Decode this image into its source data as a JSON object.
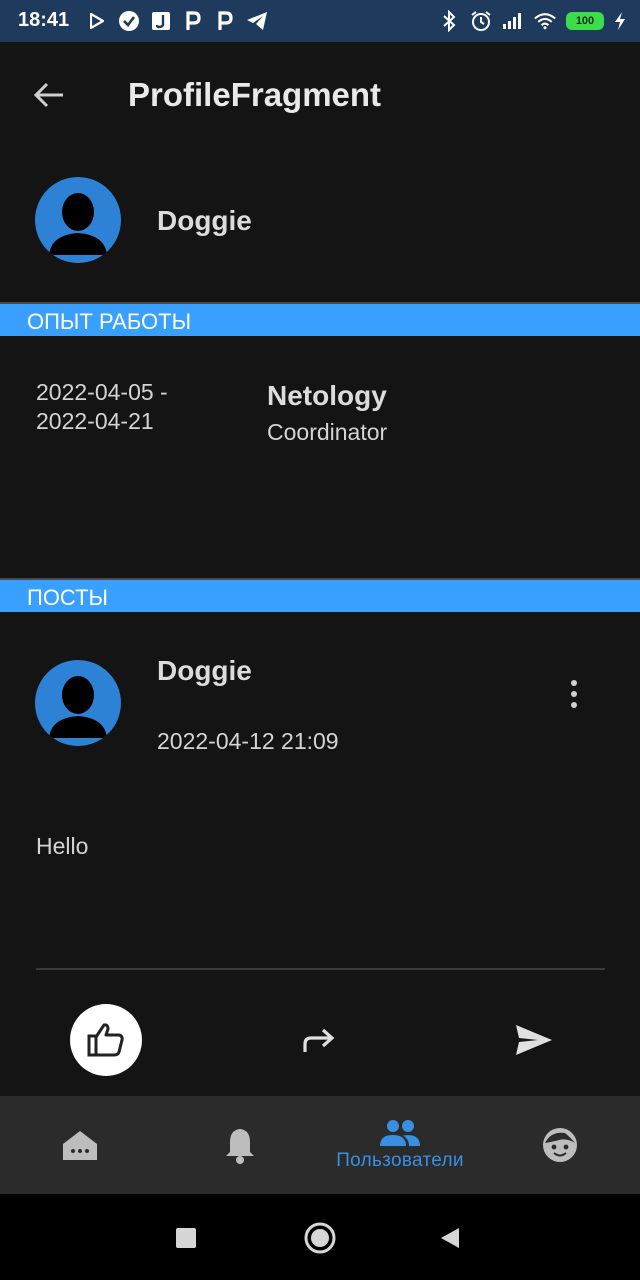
{
  "status_bar": {
    "time": "18:41",
    "battery": "100",
    "left_icons": [
      "play-store-icon",
      "check-circle-icon",
      "music-app-icon",
      "p-app-icon",
      "p-app-icon",
      "telegram-icon"
    ],
    "right_icons": [
      "bluetooth-icon",
      "alarm-icon",
      "signal-icon",
      "wifi-icon",
      "battery-icon",
      "charging-icon"
    ]
  },
  "app_bar": {
    "title": "ProfileFragment",
    "back_icon": "arrow-back-icon"
  },
  "profile": {
    "name": "Doggie",
    "avatar_icon": "person-avatar-icon"
  },
  "experience": {
    "header": "ОПЫТ РАБОТЫ",
    "items": [
      {
        "start": "2022-04-05 -",
        "end": "2022-04-21",
        "company": "Netology",
        "position": "Coordinator"
      }
    ]
  },
  "posts": {
    "header": "ПОСТЫ",
    "items": [
      {
        "author": "Doggie",
        "published": "2022-04-12 21:09",
        "content": "Hello",
        "liked": true
      }
    ]
  },
  "bottom_nav": {
    "items": [
      {
        "icon": "home-icon",
        "label": "",
        "active": false
      },
      {
        "icon": "bell-icon",
        "label": "",
        "active": false
      },
      {
        "icon": "people-icon",
        "label": "Пользователи",
        "active": true
      },
      {
        "icon": "face-icon",
        "label": "",
        "active": false
      }
    ]
  },
  "colors": {
    "accent": "#3aa0ff",
    "nav_active": "#3a8fe0",
    "avatar": "#2e82d6",
    "background": "#141414",
    "status_bar": "#1e3a5c"
  }
}
